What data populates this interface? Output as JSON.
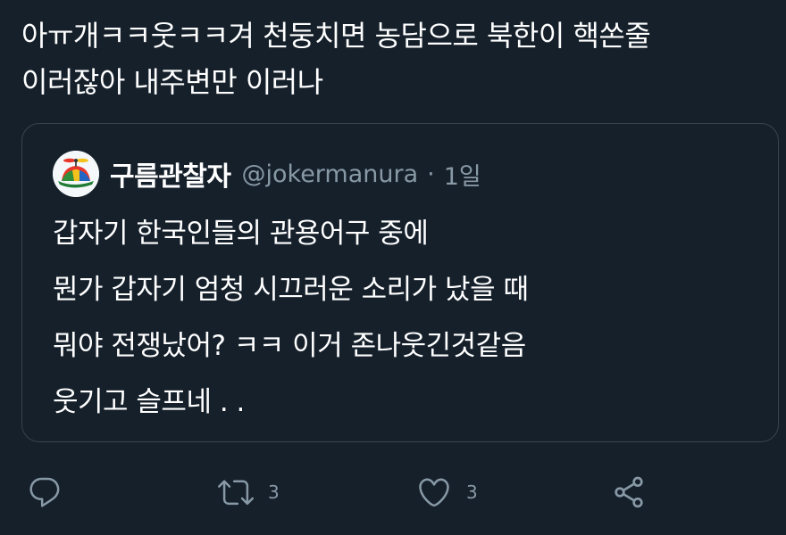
{
  "tweet": {
    "text_lines": [
      "아ㅠ개ㅋㅋ웃ㅋㅋ겨 천둥치면 농담으로 북한이 핵쏜줄",
      "이러잖아 내주변만 이러나"
    ]
  },
  "quote": {
    "display_name": "구름관찰자",
    "handle": "@jokermanura",
    "separator": "·",
    "time": "1일",
    "body_lines": [
      "갑자기 한국인들의 관용어구 중에",
      "뭔가 갑자기 엄청 시끄러운 소리가 났을 때",
      "뭐야 전쟁났어? ㅋㅋ 이거 존나웃긴것같음",
      "웃기고 슬프네 . ."
    ],
    "avatar_icon": "propeller-cap-icon"
  },
  "actions": {
    "reply_icon": "reply-icon",
    "retweet_icon": "retweet-icon",
    "retweet_count": "3",
    "like_icon": "heart-icon",
    "like_count": "3",
    "share_icon": "share-icon"
  },
  "colors": {
    "background": "#15202b",
    "text": "#ffffff",
    "secondary_text": "#8899a6",
    "border": "#38444d"
  }
}
